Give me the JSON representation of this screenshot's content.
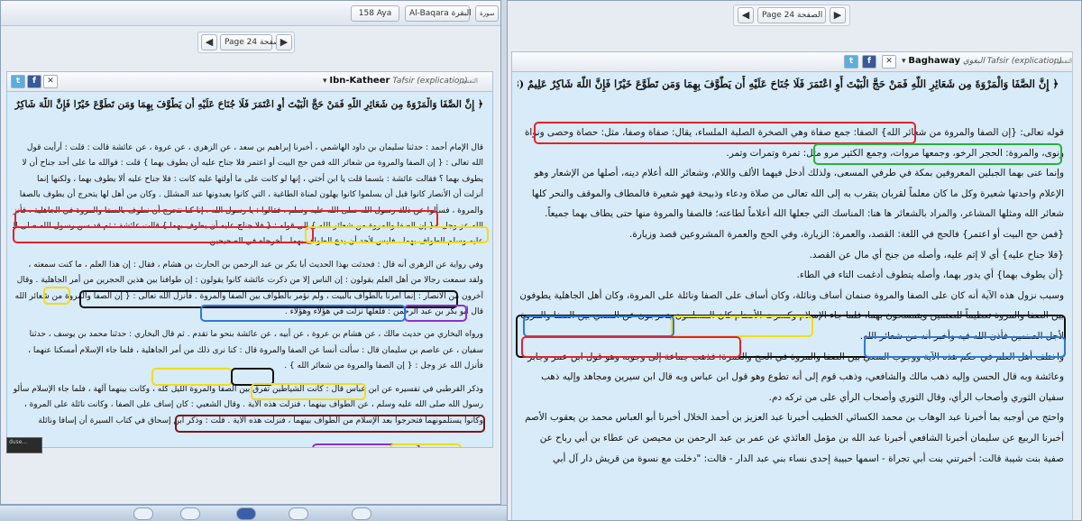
{
  "left": {
    "toolbar": {
      "ayah_select": "158 Aya",
      "surah_select": "Al-Baqara البقرة",
      "surah_word": "سورة",
      "ayah_word": "آية"
    },
    "pager": {
      "label": "Page 24 الصفحة"
    },
    "panel": {
      "title_name": "Ibn-Katheer",
      "title_tafsir": "Tafsir (explication)",
      "title_ar": "تفسير ابن كثير",
      "title_prefix": "التفسير",
      "ayah": "﴿ إِنَّ الصَّفَا وَالْمَرْوَةَ مِن شَعَائِرِ اللَّهِ فَمَنْ حَجَّ الْبَيْتَ أَوِ اعْتَمَرَ فَلَا جُنَاحَ عَلَيْهِ أَن يَطَّوَّفَ بِهِمَا وَمَن تَطَوَّعَ خَيْرًا فَإِنَّ اللَّهَ شَاكِرٌ عَلِيمٌ (158) ﴾",
      "lines": [
        "قال الإمام أحمد : حدثنا سليمان بن داود الهاشمي ، أخبرنا إبراهيم بن سعد ، عن الزهري ، عن عروة ، عن عائشة قالت : قلت : أرأيت قول",
        "الله تعالى : { إن الصفا والمروة من شعائر الله فمن حج البيت أو اعتمر فلا جناح عليه أن يطوف بهما } قلت : فوالله ما على أحد جناح أن لا",
        "يطوف بهما ؟ فقالت عائشة : بئسما قلت يا ابن أختي ، إنها لو كانت على ما أولتها عليه كانت : فلا جناح عليه ألا يطوف بهما ، ولكنها إنما",
        "أنزلت أن الأنصار كانوا قبل أن يسلموا كانوا يهلون لمناة الطاغية ، التي كانوا يعبدونها عند المشلل . وكان من أهل لها يتحرج أن يطوف بالصفا",
        "والمروة ، فسألوا عن ذلك رسول الله صلى الله عليه وسلم ، فقالوا : يا رسول الله ، إنا كنا نتحرج أن نطوف بالصفا والمروة في الجاهلية . فأنزل",
        "الله عز وجل : { إن الصفا والمروة من شعائر الله } إلى قوله : { فلا جناح عليه أن يطوف بهما } قالت عائشة : ثم قد سن رسول الله صلى الله",
        "عليه وسلم الطواف بهما ، فليس لأحد أن يدع الطواف بهما . أخرجاه في الصحيحين .",
        "",
        "وفي رواية عن الزهري أنه قال : فحدثت بهذا الحديث أبا بكر بن عبد الرحمن بن الحارث بن هشام ، فقال : إن هذا العلم ، ما كنت سمعته ،",
        "ولقد سمعت رجالا من أهل العلم يقولون : إن الناس إلا من ذكرت عائشة كانوا يقولون : إن طوافنا بين هذين الحجرين من أمر الجاهلية . وقال",
        "آخرون من الأنصار : إنما أمرنا بالطواف بالبيت ، ولم نؤمر بالطواف بين الصفا والمروة . فأنزل الله تعالى : { إن الصفا والمروة من شعائر الله }",
        "قال أبو بكر بن عبد الرحمن : فلعلها نزلت في هؤلاء وهؤلاء .",
        "",
        "ورواه البخاري من حديث مالك ، عن هشام بن عروة ، عن أبيه ، عن عائشة بنحو ما تقدم . ثم قال البخاري : حدثنا محمد بن يوسف ، حدثنا",
        "سفيان ، عن عاصم بن سليمان قال : سألت أنسا عن الصفا والمروة قال : كنا نرى ذلك من أمر الجاهلية ، فلما جاء الإسلام أمسكنا عنهما ،",
        "فأنزل الله عز وجل : { إن الصفا والمروة من شعائر الله } .",
        "",
        "وذكر القرطبي في تفسيره عن ابن عباس قال : كانت الشياطين تفرق بين الصفا والمروة الليل كله ، وكانت بينهما آلهة ، فلما جاء الإسلام سألوا",
        "رسول الله صلى الله عليه وسلم ، عن الطواف بينهما ، فنزلت هذه الآية . وقال الشعبي : كان إساف على الصفا ، وكانت نائلة على المروة ،",
        "وكانوا يستلمونهما فتحرجوا بعد الإسلام من الطواف بينهما ، فنزلت هذه الآية . قلت : وذكر ابن إسحاق في كتاب السيرة أن إسافا ونائلة"
      ]
    }
  },
  "right": {
    "pager": {
      "label": "Page 24 الصفحة"
    },
    "panel": {
      "title_name": "Baghaway",
      "title_tafsir": "Tafsir (explication)",
      "title_ar": "البغوي",
      "title_prefix": "التفسير",
      "ayah": "﴿ إِنَّ الصَّفَا وَالْمَرْوَةَ مِن شَعَائِرِ اللَّهِ فَمَنْ حَجَّ الْبَيْتَ أَوِ اعْتَمَرَ فَلَا جُنَاحَ عَلَيْهِ أَن يَطَّوَّفَ بِهِمَا وَمَن تَطَوَّعَ خَيْرًا فَإِنَّ اللَّهَ شَاكِرٌ عَلِيمٌ (158) ﴾",
      "lines": [
        "قوله تعالى: {إن الصفا والمروة من شعائر الله} الصفا: جمع صفاة وهي الصخرة الصلبة الملساء، يقال: صفاة وصفا، مثل: حصاة وحصى ونواة",
        "ونوى، والمروة: الحجر الرخو، وجمعها مروات، وجمع الكثير مرو مثل: تمرة وتمرات وتمر.",
        "وإنما عنى بهما الجبلين المعروفين بمكة في طرفي المسعى، ولذلك أدخل فيهما الألف واللام، وشعائر الله أعلام دينه، أصلها من الإشعار وهو",
        "الإعلام واحدتها شعيرة وكل ما كان معلماً لقربان يتقرب به إلى الله تعالى من صلاة ودعاء وذبيحة فهو شعيرة فالمطاف والموقف والنحر كلها",
        "شعائر الله ومثلها المشاعر، والمراد بالشعائر ها هنا: المناسك التي جعلها الله أعلاماً لطاعته؛ فالصفا والمروة منها حتى يطاف بهما جميعاً.",
        "{فمن حج البيت أو اعتمر} فالحج في اللغة: القصد، والعمرة: الزيارة، وفي الحج والعمرة المشروعين قصد وزيارة.",
        "{فلا جناح عليه} أي لا إثم عليه، وأصله من جنح أي مال عن القصد.",
        "{أن يطوف بهما} أي يدور بهما، وأصله يتطوف أدغمت التاء في الطاء.",
        "وسبب نزول هذه الآية أنه كان على الصفا والمروة صنمان أساف ونائلة، وكان أساف على الصفا ونائلة على المروة، وكان أهل الجاهلية يطوفون",
        "بين الصفا والمروة تعظيماً للصنمين ويتمسحون بهما، فلما جاء الإسلام وكسرت الأصنام كان المسلمون يتحرجون عن السعي بين الصفا والمروة",
        "لأجل الصنمين فأذن الله فيه وأخبر أنه من شعائر الله.",
        "واختلف أهل العلم في حكم هذه الآية ووجوب السعي بين الصفا والمروة في الحج والعمرة: فذهب جماعة إلى وجوبه وهو قول ابن عمر وجابر",
        "وعائشة وبه قال الحسن وإليه ذهب مالك والشافعي، وذهب قوم إلى أنه تطوع وهو قول ابن عباس وبه قال ابن سيرين ومجاهد وإليه ذهب",
        "سفيان الثوري وأصحاب الرأي، وقال الثوري وأصحاب الرأي على من تركه دم.",
        "واحتج من أوجبه بما أخبرنا عبد الوهاب بن محمد الكسائي الخطيب أخبرنا عبد العزيز بن أحمد الخلال أخبرنا أبو العباس محمد بن يعقوب الأصم",
        "أخبرنا الربيع عن سليمان أخبرنا الشافعي أخبرنا عبد الله بن مؤمل العائذي عن عمر بن عبد الرحمن بن محيصن عن عطاء بن أبي رباح عن",
        "صفية بنت شيبة قالت: أخبرتني بنت أبي تجراة - اسمها حبيبة إحدى نساء بني عبد الدار - قالت: \"دخلت مع نسوة من قريش دار آل أبي"
      ]
    }
  },
  "colors": {
    "red": "#e3222b",
    "yellow": "#f1dd1b",
    "black": "#111111",
    "blue": "#2f79d6",
    "green": "#27b23b",
    "purple": "#8f2fd0",
    "panel_bg": "#d8ebf8"
  },
  "icons": [
    "twitter-icon",
    "facebook-icon",
    "close-icon",
    "dropdown-arrow-icon",
    "page-prev-icon",
    "page-next-icon"
  ]
}
